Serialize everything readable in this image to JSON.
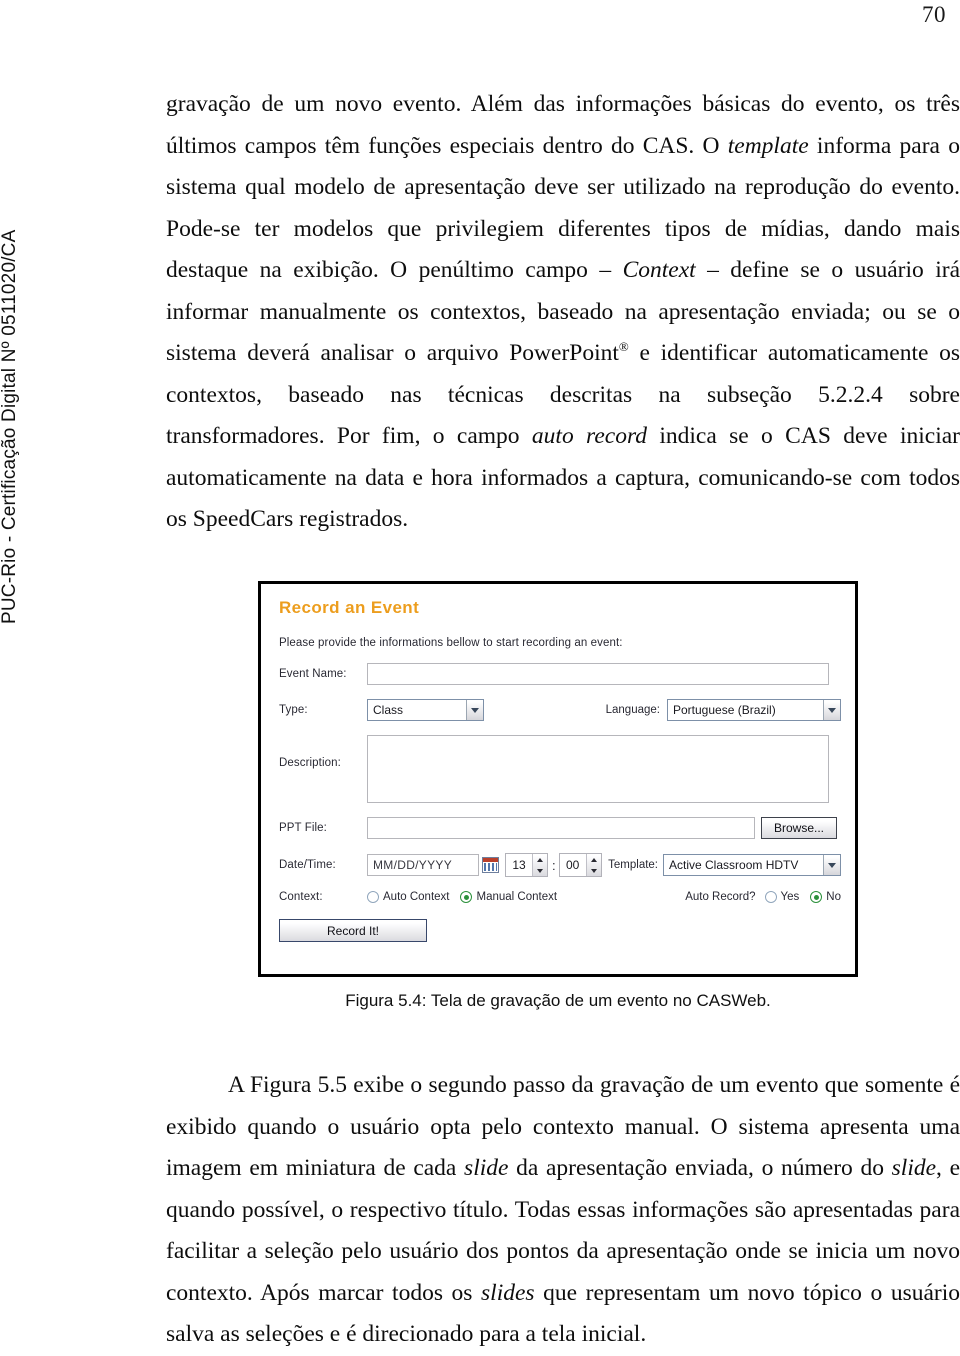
{
  "page": {
    "number": "70",
    "vertical_stamp": "PUC-Rio - Certificação Digital Nº 0511020/CA"
  },
  "paragraphs": {
    "top_part1": "gravação de um novo evento. Além das informações básicas do evento, os três últimos campos têm funções especiais dentro do CAS. O ",
    "top_em1": "template",
    "top_part2": " informa para o sistema qual modelo de apresentação deve ser utilizado na reprodução do evento. Pode-se ter modelos que privilegiem diferentes tipos de mídias, dando mais destaque na exibição. O penúltimo campo – ",
    "top_em2": "Context",
    "top_part3": " – define se o usuário irá informar manualmente os contextos, baseado na apresentação enviada; ou se o sistema deverá analisar o arquivo PowerPoint",
    "top_reg": "®",
    "top_part4": " e identificar automaticamente os contextos, baseado nas técnicas descritas na subseção 5.2.2.4 sobre transformadores. Por fim, o campo ",
    "top_em3": "auto record",
    "top_part5": " indica se o CAS deve iniciar automaticamente na data e hora informados a captura, comunicando-se com todos os SpeedCars registrados.",
    "bottom_part1": "A Figura 5.5 exibe o segundo passo da gravação de um evento que somente é exibido quando o usuário opta pelo contexto manual. O sistema apresenta uma imagem em miniatura de cada ",
    "bottom_em1": "slide",
    "bottom_part2": " da apresentação enviada, o número do ",
    "bottom_em2": "slide",
    "bottom_part3": ", e quando possível, o respectivo título. Todas essas informações são apresentadas para facilitar a seleção pelo usuário dos pontos da apresentação onde se inicia um novo contexto. Após marcar todos os ",
    "bottom_em3": "slides",
    "bottom_part4": " que representam um novo tópico o usuário salva as seleções e é direcionado para a tela inicial."
  },
  "figure": {
    "caption": "Figura 5.4: Tela de gravação de um evento no CASWeb.",
    "form": {
      "title": "Record an Event",
      "title_color": "#e79c23",
      "subtitle": "Please provide the informations bellow to start recording an event:",
      "labels": {
        "event_name": "Event Name:",
        "type": "Type:",
        "language": "Language:",
        "description": "Description:",
        "ppt_file": "PPT File:",
        "date_time": "Date/Time:",
        "template": "Template:",
        "context": "Context:",
        "auto_record": "Auto Record?"
      },
      "values": {
        "event_name": "",
        "type": "Class",
        "language": "Portuguese (Brazil)",
        "description": "",
        "ppt_file": "",
        "date_placeholder": "MM/DD/YYYY",
        "hour": "13",
        "time_separator": ":",
        "minute": "00",
        "template": "Active Classroom HDTV"
      },
      "radios": {
        "auto_context": "Auto Context",
        "manual_context": "Manual Context",
        "yes": "Yes",
        "no": "No",
        "context_selected": "Manual Context",
        "auto_record_selected": "No"
      },
      "buttons": {
        "browse": "Browse...",
        "record": "Record It!"
      }
    }
  }
}
